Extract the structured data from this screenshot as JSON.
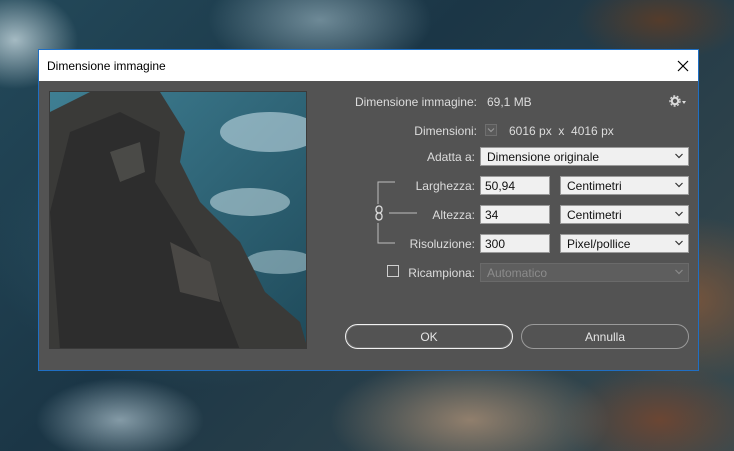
{
  "dialog": {
    "title": "Dimensione immagine",
    "image_size_label": "Dimensione immagine:",
    "image_size_value": "69,1 MB",
    "dimensions_label": "Dimensioni:",
    "dimensions_value": "6016 px  x  4016 px",
    "fit_label": "Adatta a:",
    "fit_value": "Dimensione originale",
    "width_label": "Larghezza:",
    "width_value": "50,94",
    "width_unit": "Centimetri",
    "height_label": "Altezza:",
    "height_value": "34",
    "height_unit": "Centimetri",
    "resolution_label": "Risoluzione:",
    "resolution_value": "300",
    "resolution_unit": "Pixel/pollice",
    "resample_label": "Ricampiona:",
    "resample_value": "Automatico",
    "ok_label": "OK",
    "cancel_label": "Annulla",
    "icons": [
      "close-icon",
      "gear-icon",
      "chain-link-icon",
      "chevron-down-icon"
    ]
  }
}
